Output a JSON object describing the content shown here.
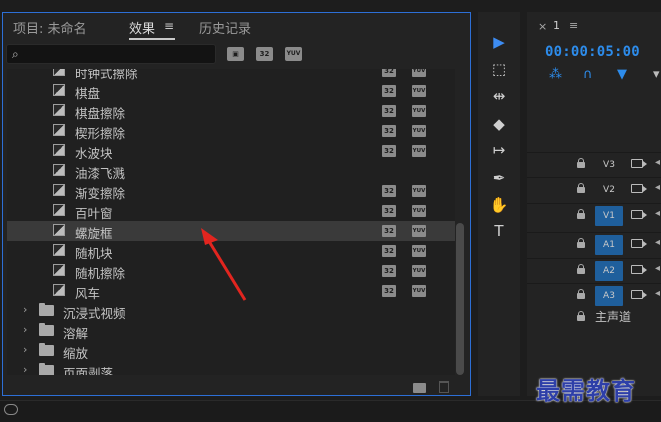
{
  "effects_panel": {
    "tabs": [
      {
        "label": "项目: 未命名",
        "active": false
      },
      {
        "label": "效果",
        "active": true,
        "menu_icon": "hamburger-icon"
      },
      {
        "label": "历史记录",
        "active": false
      }
    ],
    "search": {
      "placeholder": "",
      "value": "",
      "icon": "search-icon"
    },
    "filter_buttons": [
      {
        "label": "",
        "icon": "accelerated-effects-icon"
      },
      {
        "label": "32",
        "icon": "32bit-icon"
      },
      {
        "label": "YUV",
        "icon": "yuv-icon"
      }
    ],
    "items": [
      {
        "label": "时钟式擦除",
        "type": "effect",
        "b32": "32",
        "yuv": "YUV",
        "selected": false
      },
      {
        "label": "棋盘",
        "type": "effect",
        "b32": "32",
        "yuv": "YUV",
        "selected": false
      },
      {
        "label": "棋盘擦除",
        "type": "effect",
        "b32": "32",
        "yuv": "YUV",
        "selected": false
      },
      {
        "label": "楔形擦除",
        "type": "effect",
        "b32": "32",
        "yuv": "YUV",
        "selected": false
      },
      {
        "label": "水波块",
        "type": "effect",
        "b32": "32",
        "yuv": "YUV",
        "selected": false
      },
      {
        "label": "油漆飞溅",
        "type": "effect",
        "b32": "",
        "yuv": "",
        "selected": false
      },
      {
        "label": "渐变擦除",
        "type": "effect",
        "b32": "32",
        "yuv": "YUV",
        "selected": false
      },
      {
        "label": "百叶窗",
        "type": "effect",
        "b32": "32",
        "yuv": "YUV",
        "selected": false
      },
      {
        "label": "螺旋框",
        "type": "effect",
        "b32": "32",
        "yuv": "YUV",
        "selected": true
      },
      {
        "label": "随机块",
        "type": "effect",
        "b32": "32",
        "yuv": "YUV",
        "selected": false
      },
      {
        "label": "随机擦除",
        "type": "effect",
        "b32": "32",
        "yuv": "YUV",
        "selected": false
      },
      {
        "label": "风车",
        "type": "effect",
        "b32": "32",
        "yuv": "YUV",
        "selected": false
      },
      {
        "label": "沉浸式视频",
        "type": "folder"
      },
      {
        "label": "溶解",
        "type": "folder"
      },
      {
        "label": "缩放",
        "type": "folder"
      },
      {
        "label": "页面剥落",
        "type": "folder"
      }
    ]
  },
  "tools": [
    {
      "name": "selection-tool",
      "glyph": "▶",
      "active": true
    },
    {
      "name": "track-select-tool",
      "glyph": "⬚",
      "active": false
    },
    {
      "name": "ripple-edit-tool",
      "glyph": "⇹",
      "active": false
    },
    {
      "name": "razor-tool",
      "glyph": "◆",
      "active": false
    },
    {
      "name": "slip-tool",
      "glyph": "↦",
      "active": false
    },
    {
      "name": "pen-tool",
      "glyph": "✒",
      "active": false
    },
    {
      "name": "hand-tool",
      "glyph": "✋",
      "active": false
    },
    {
      "name": "type-tool",
      "glyph": "T",
      "active": false
    }
  ],
  "timeline": {
    "close": "×",
    "sequence": "1",
    "menu": "≡",
    "timecode": "00:00:05:00",
    "icons": [
      "snap-icon",
      "link-icon",
      "marker-icon"
    ],
    "tracks": [
      {
        "label": "V3",
        "on": false
      },
      {
        "label": "V2",
        "on": false
      },
      {
        "label": "V1",
        "on": true
      },
      {
        "label": "A1",
        "on": true
      },
      {
        "label": "A2",
        "on": true
      },
      {
        "label": "A3",
        "on": true
      }
    ],
    "master": "主声道"
  },
  "watermark": "最需教育"
}
